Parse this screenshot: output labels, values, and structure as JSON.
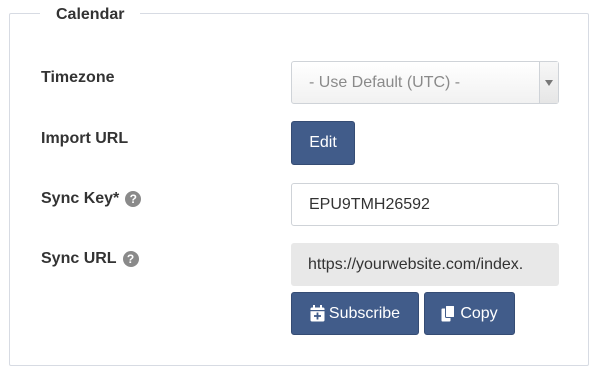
{
  "section": {
    "legend": "Calendar"
  },
  "timezone": {
    "label": "Timezone",
    "selected": "- Use Default (UTC) -"
  },
  "import_url": {
    "label": "Import URL",
    "button": "Edit"
  },
  "sync_key": {
    "label": "Sync Key*",
    "value": "EPU9TMH26592",
    "help": "?"
  },
  "sync_url": {
    "label": "Sync URL",
    "value": "https://yourwebsite.com/index.",
    "help": "?",
    "subscribe_button": "Subscribe",
    "copy_button": "Copy"
  },
  "colors": {
    "button": "#415c8a",
    "readonly_bg": "#e8e8e8",
    "border": "#cfd3d8"
  },
  "icons": {
    "help": "question-circle-icon",
    "subscribe": "calendar-plus-icon",
    "copy": "copy-icon",
    "select": "select-arrow-icon"
  }
}
